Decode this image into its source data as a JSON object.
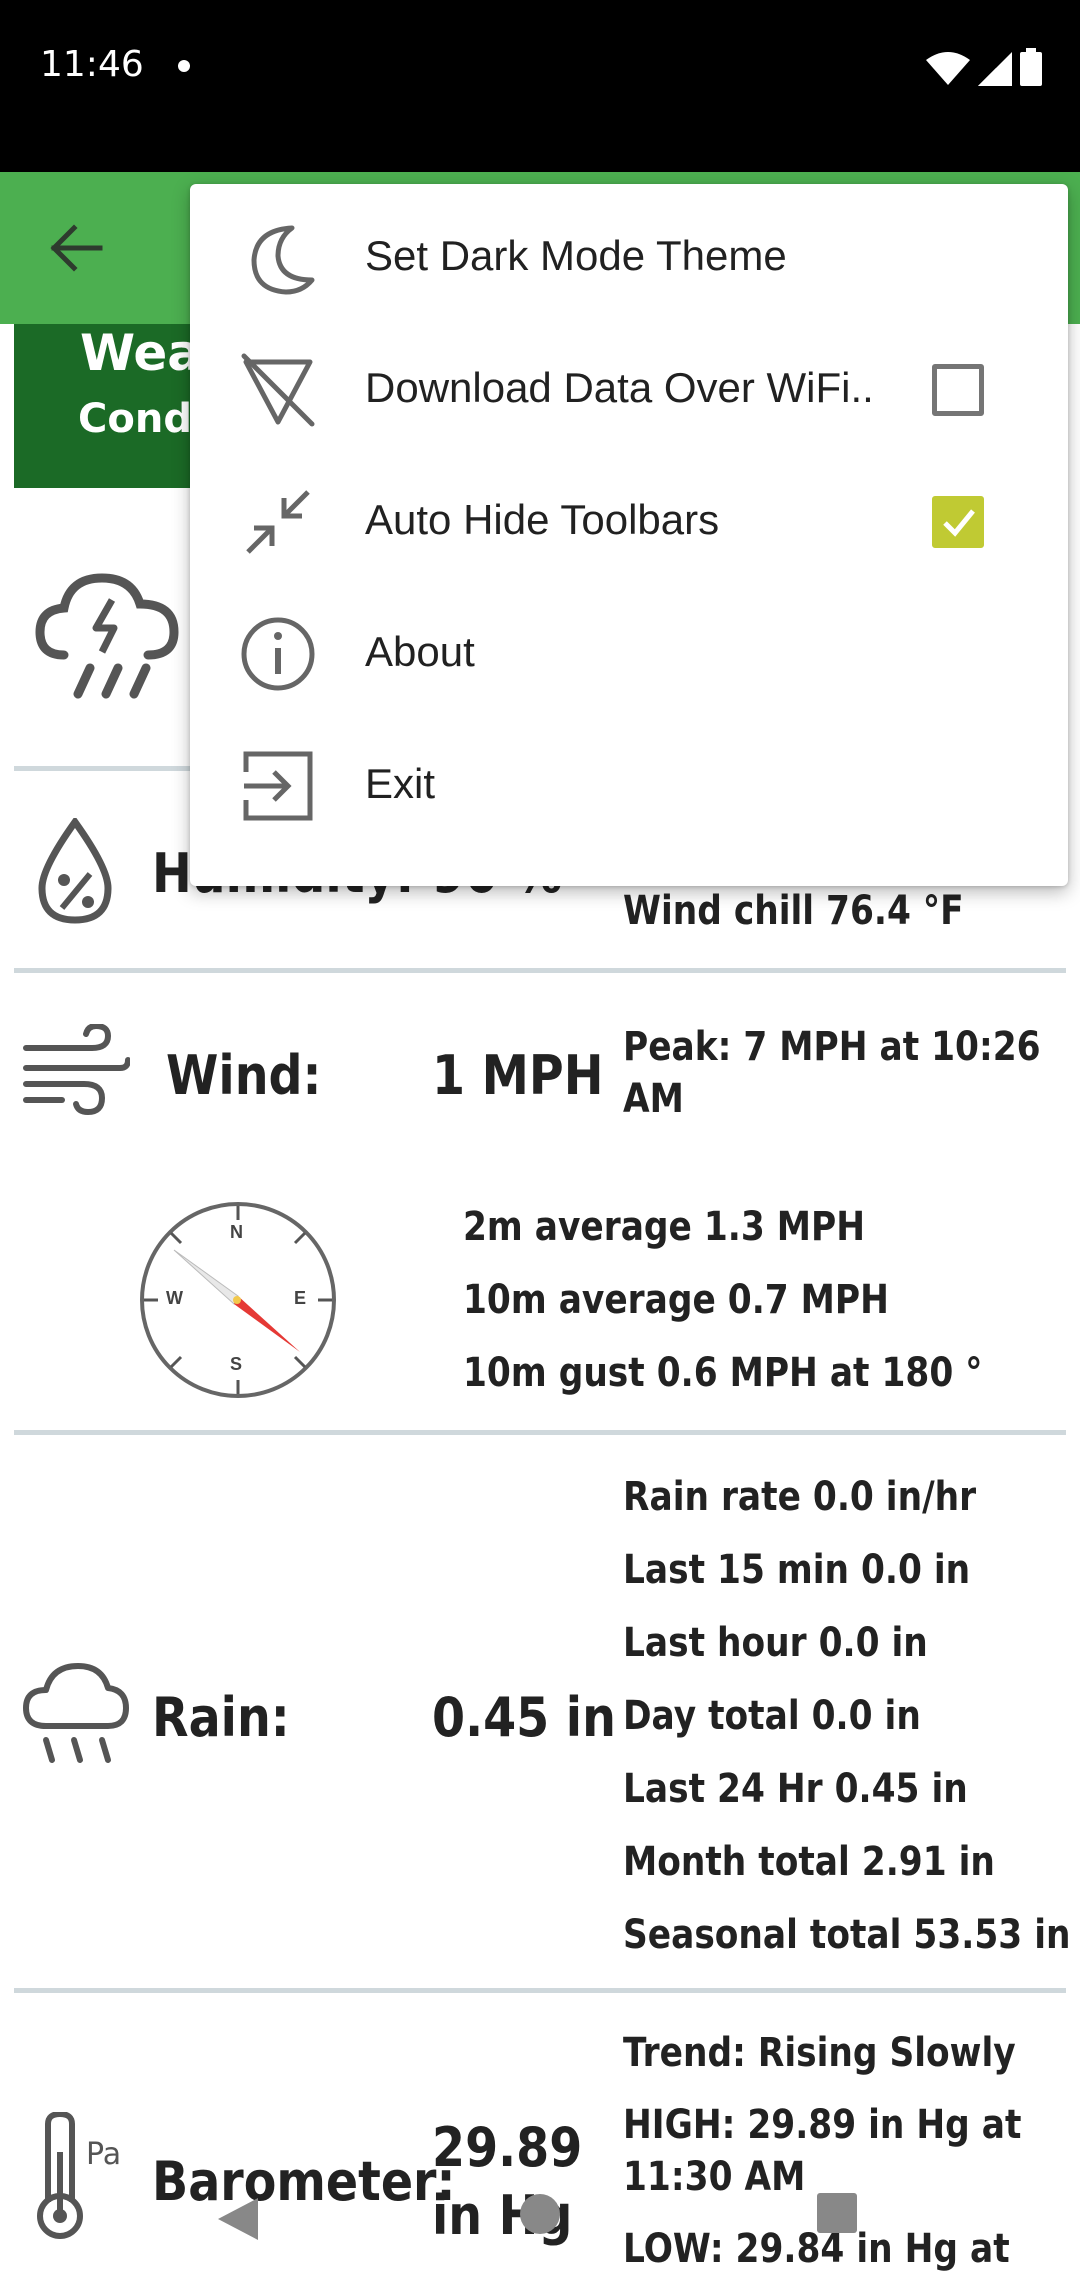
{
  "status_bar": {
    "time": "11:46"
  },
  "header": {
    "title": "Weat",
    "subtitle": "Condit"
  },
  "rows": {
    "humidity": {
      "label": "Humidity:",
      "value": "90 %",
      "detail": "Wind chill 76.4 °F"
    },
    "wind": {
      "label": "Wind:",
      "value": "1 MPH",
      "peak_line1": "Peak: 7 MPH at 10:26",
      "peak_line2": "AM",
      "compass": {
        "n": "N",
        "e": "E",
        "s": "S",
        "w": "W"
      },
      "details": [
        "2m average 1.3 MPH",
        "10m average 0.7 MPH",
        "10m gust 0.6 MPH at 180 °"
      ]
    },
    "rain": {
      "label": "Rain:",
      "value": "0.45 in",
      "details": [
        "Rain rate 0.0 in/hr",
        "Last 15 min 0.0 in",
        "Last hour 0.0 in",
        "Day total 0.0 in",
        "Last 24 Hr 0.45 in",
        "Month total 2.91 in",
        "Seasonal total 53.53 in"
      ]
    },
    "barometer": {
      "label": "Barometer:",
      "value_line1": "29.89",
      "value_line2": "in Hg",
      "icon_unit": "Pa",
      "details": [
        "Trend: Rising Slowly",
        "HIGH: 29.89  in Hg at",
        "11:30 AM",
        "LOW: 29.84  in Hg at"
      ]
    }
  },
  "menu": {
    "items": [
      {
        "label": "Set Dark Mode Theme",
        "icon": "moon-icon"
      },
      {
        "label": "Download Data Over WiFi..",
        "icon": "wifi-off-icon",
        "checkbox": false
      },
      {
        "label": "Auto Hide Toolbars",
        "icon": "collapse-icon",
        "checkbox": true
      },
      {
        "label": "About",
        "icon": "info-icon"
      },
      {
        "label": "Exit",
        "icon": "exit-icon"
      }
    ]
  },
  "colors": {
    "app_bar": "#4caf50",
    "header_card": "#1b6a26",
    "checkbox_checked": "#c0ca33"
  }
}
